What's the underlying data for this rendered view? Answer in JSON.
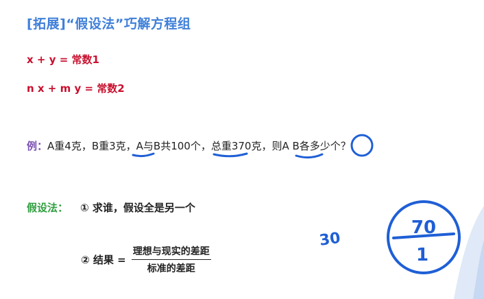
{
  "title": "[拓展]“假设法”巧解方程组",
  "formulas": [
    "x + y = 常数1",
    "n x + m y = 常数2"
  ],
  "example": {
    "label": "例：",
    "text": "A重4克，B重3克，A与B共100个，总重370克，则A B各多少个？"
  },
  "method": {
    "label": "假设法：",
    "step1": "① 求谁，假设全是另一个",
    "step2_prefix": "② 结果 =",
    "step2_numerator": "理想与现实的差距",
    "step2_denominator": "标准的差距"
  },
  "handwriting": {
    "side_note": "30",
    "circled_fraction": "70/1"
  },
  "colors": {
    "title": "#3f7fd9",
    "formula": "#c8102e",
    "example_label": "#7a4fb0",
    "method_label": "#2e9e3e",
    "ink": "#1f5fd6"
  }
}
